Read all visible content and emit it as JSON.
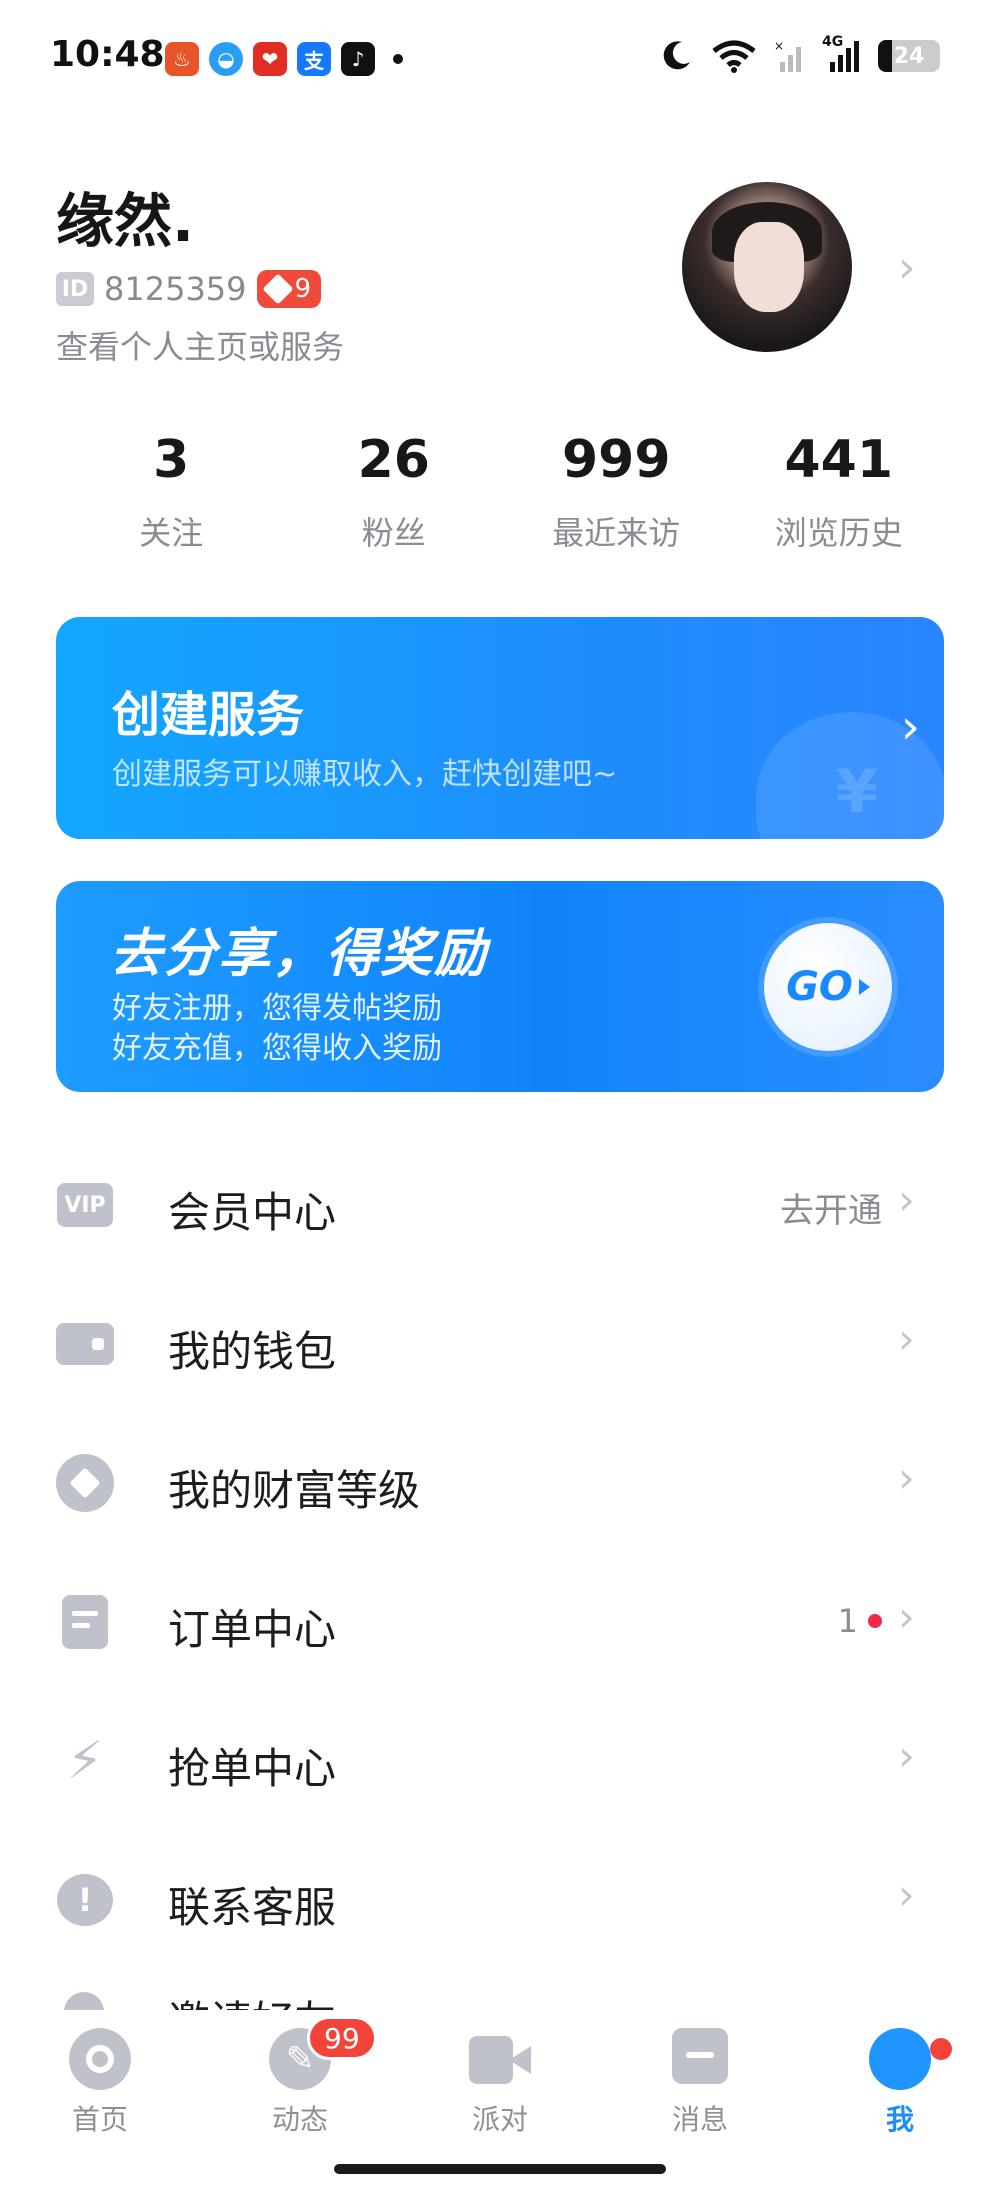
{
  "status_bar": {
    "time": "10:48",
    "app_icons": [
      "fire-app-icon",
      "browser-app-icon",
      "pinduoduo-icon",
      "alipay-icon",
      "tiktok-icon"
    ],
    "alipay_glyph": "支",
    "network": "4G",
    "battery": "24"
  },
  "profile": {
    "nickname": "缘然.",
    "id_tag": "ID",
    "id_number": "8125359",
    "level": "9",
    "subtitle": "查看个人主页或服务"
  },
  "stats": [
    {
      "value": "3",
      "label": "关注"
    },
    {
      "value": "26",
      "label": "粉丝"
    },
    {
      "value": "999",
      "label": "最近来访"
    },
    {
      "value": "441",
      "label": "浏览历史"
    }
  ],
  "banner_create": {
    "title": "创建服务",
    "subtitle": "创建服务可以赚取收入，赶快创建吧~"
  },
  "banner_share": {
    "title": "去分享，得奖励",
    "line1": "好友注册，您得发帖奖励",
    "line2": "好友充值，您得收入奖励",
    "go": "GO"
  },
  "menu": {
    "vip": {
      "label": "会员中心",
      "extra": "去开通",
      "icon_text": "VIP"
    },
    "wallet": {
      "label": "我的钱包"
    },
    "wealth": {
      "label": "我的财富等级"
    },
    "orders": {
      "label": "订单中心",
      "count": "1"
    },
    "grab": {
      "label": "抢单中心"
    },
    "service": {
      "label": "联系客服",
      "icon_text": "!"
    },
    "invite": {
      "label": "邀请好友"
    }
  },
  "tabbar": {
    "tabs": [
      {
        "label": "首页"
      },
      {
        "label": "动态"
      },
      {
        "label": "派对"
      },
      {
        "label": "消息"
      },
      {
        "label": "我"
      }
    ],
    "feed_badge": "99",
    "accent": "#1e8cff"
  }
}
